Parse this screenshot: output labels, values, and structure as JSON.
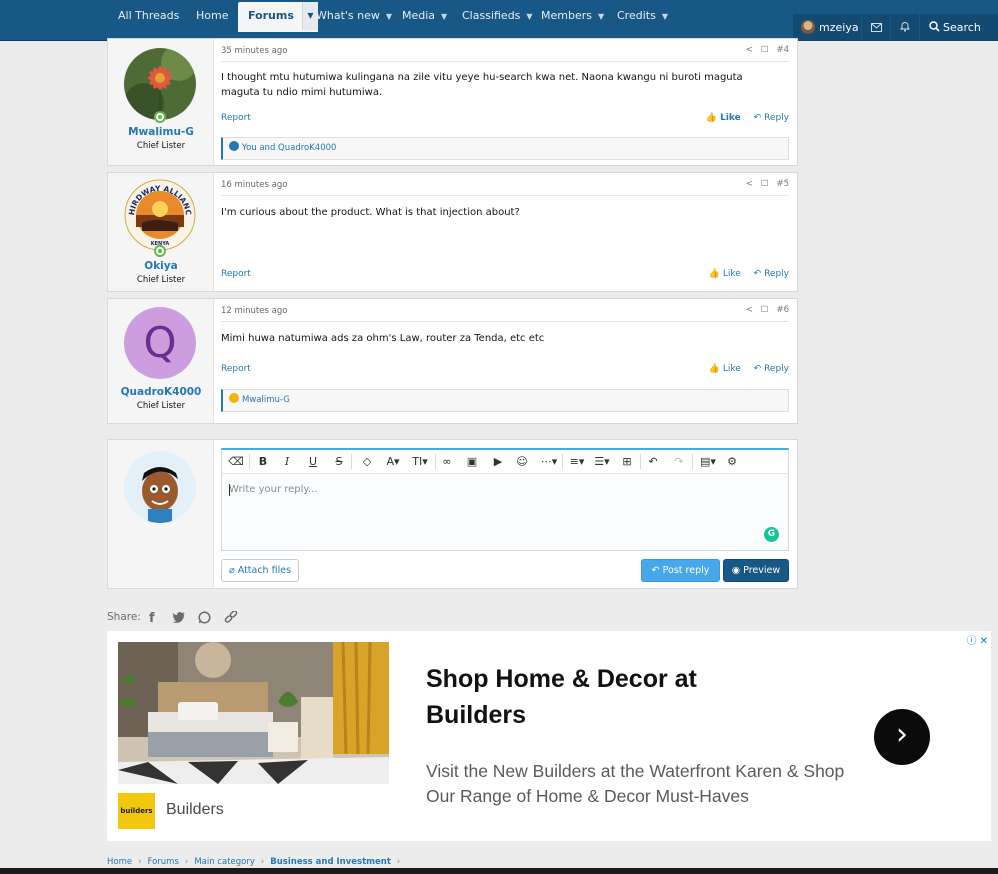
{
  "nav": {
    "items": [
      {
        "label": "All Threads"
      },
      {
        "label": "Home"
      },
      {
        "label": "Forums"
      },
      {
        "label": "What's new"
      },
      {
        "label": "Media"
      },
      {
        "label": "Classifieds"
      },
      {
        "label": "Members"
      },
      {
        "label": "Credits"
      }
    ],
    "user": "mzeiya",
    "search_label": "Search"
  },
  "posts": [
    {
      "time": "35 minutes ago",
      "number": "#4",
      "username": "Mwalimu-G",
      "user_title": "Chief Lister",
      "body": "I thought mtu hutumiwa kulingana na zile vitu yeye hu-search kwa net. Naona kwangu ni buroti maguta maguta tu ndio mimi hutumiwa.",
      "report": "Report",
      "like": "Like",
      "reply": "Reply",
      "reactions": "You and QuadroK4000"
    },
    {
      "time": "16 minutes ago",
      "number": "#5",
      "username": "Okiya",
      "user_title": "Chief Lister",
      "avatar_text": "THIRDWAY ALLIANCE",
      "avatar_subtext": "KENYA",
      "body": "I'm curious about the product. What is that injection about?",
      "report": "Report",
      "like": "Like",
      "reply": "Reply"
    },
    {
      "time": "12 minutes ago",
      "number": "#6",
      "username": "QuadroK4000",
      "user_title": "Chief Lister",
      "avatar_letter": "Q",
      "body": "Mimi huwa natumiwa ads za ohm's Law, router za Tenda, etc etc",
      "report": "Report",
      "like": "Like",
      "reply": "Reply",
      "reactions": "Mwalimu-G"
    }
  ],
  "editor": {
    "placeholder": "Write your reply...",
    "attach_label": "Attach files",
    "post_reply_label": "Post reply",
    "preview_label": "Preview"
  },
  "share": {
    "label": "Share:"
  },
  "ad": {
    "title": "Shop Home & Decor at Builders",
    "description": "Visit the New Builders at the Waterfront Karen & Shop Our Range of Home & Decor Must-Haves",
    "brand": "Builders",
    "logo_text": "builders"
  },
  "breadcrumb": [
    "Home",
    "Forums",
    "Main category",
    "Business and Investment"
  ],
  "colors": {
    "nav_bg": "#185886",
    "link": "#2577b1",
    "accent": "#47a7eb",
    "online": "#63b64b"
  }
}
